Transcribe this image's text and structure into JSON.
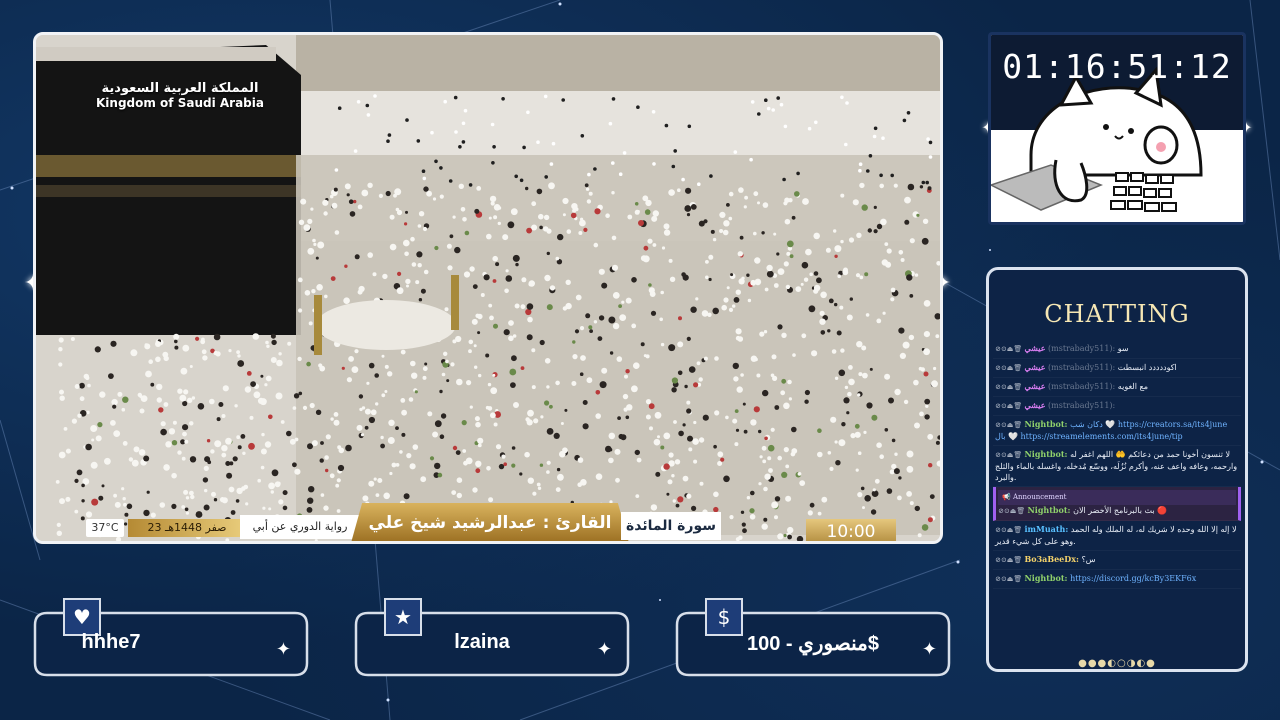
{
  "video": {
    "kingdom_ar": "المملكة العربية السعودية",
    "kingdom_en": "Kingdom of Saudi Arabia",
    "temperature": "37°C",
    "date": "23 صفر 1448هـ",
    "riwaya": "رواية الدوري عن أبي عمرو",
    "qari": "القارئ : عبدالرشيد شيخ علي",
    "surah": "سورة المائدة",
    "time": "10:00"
  },
  "timer": {
    "value": "01:16:51:12"
  },
  "chat": {
    "title": "CHATTING",
    "messages": [
      {
        "user": "عيشي",
        "handle": "(mstrabady511)",
        "text": "سو",
        "dim": true
      },
      {
        "user": "عيشي",
        "handle": "(mstrabady511)",
        "text": "اكوددددد انبسطت"
      },
      {
        "user": "عيشي",
        "handle": "(mstrabady511)",
        "text": "مع الغويه"
      },
      {
        "user": "عيشي",
        "handle": "(mstrabady511)",
        "text": ""
      },
      {
        "user": "Nightbot:",
        "text": "دكان شب 🤍 https://creators.sa/its4june بال 🤍 https://streamelements.com/its4june/tip",
        "link": true
      },
      {
        "user": "Nightbot:",
        "text": "لا تنسون أخونا حمد من دعائكم 🤲 اللهم اغفر له وارحمه، وعافه واعف عنه، وأكرم نُزُلَه، ووسّع مُدخله، واغسله بالماء والثلج والبرد."
      },
      {
        "user": "Nightbot:",
        "text": "بث بالبرنامج الأخضر الان 🔴",
        "announcement": "Announcement"
      },
      {
        "user": "imMuath:",
        "text": "لا إله إلا الله وحده لا شريك له، له الملك وله الحمد وهو على كل شيء قدير."
      },
      {
        "user": "Bo3aBeeDx:",
        "text": "س؟"
      },
      {
        "user": "Nightbot:",
        "text": "https://discord.gg/kcBy3EKF6x",
        "link": true
      }
    ],
    "pager": "●●●◐○◑◐●"
  },
  "boxes": [
    {
      "icon": "heart-icon",
      "glyph": "♥",
      "text": "hhhe7"
    },
    {
      "icon": "star-icon",
      "glyph": "★",
      "text": "lzaina"
    },
    {
      "icon": "dollar-icon",
      "glyph": "$",
      "text": "منصوري - 100$"
    }
  ]
}
